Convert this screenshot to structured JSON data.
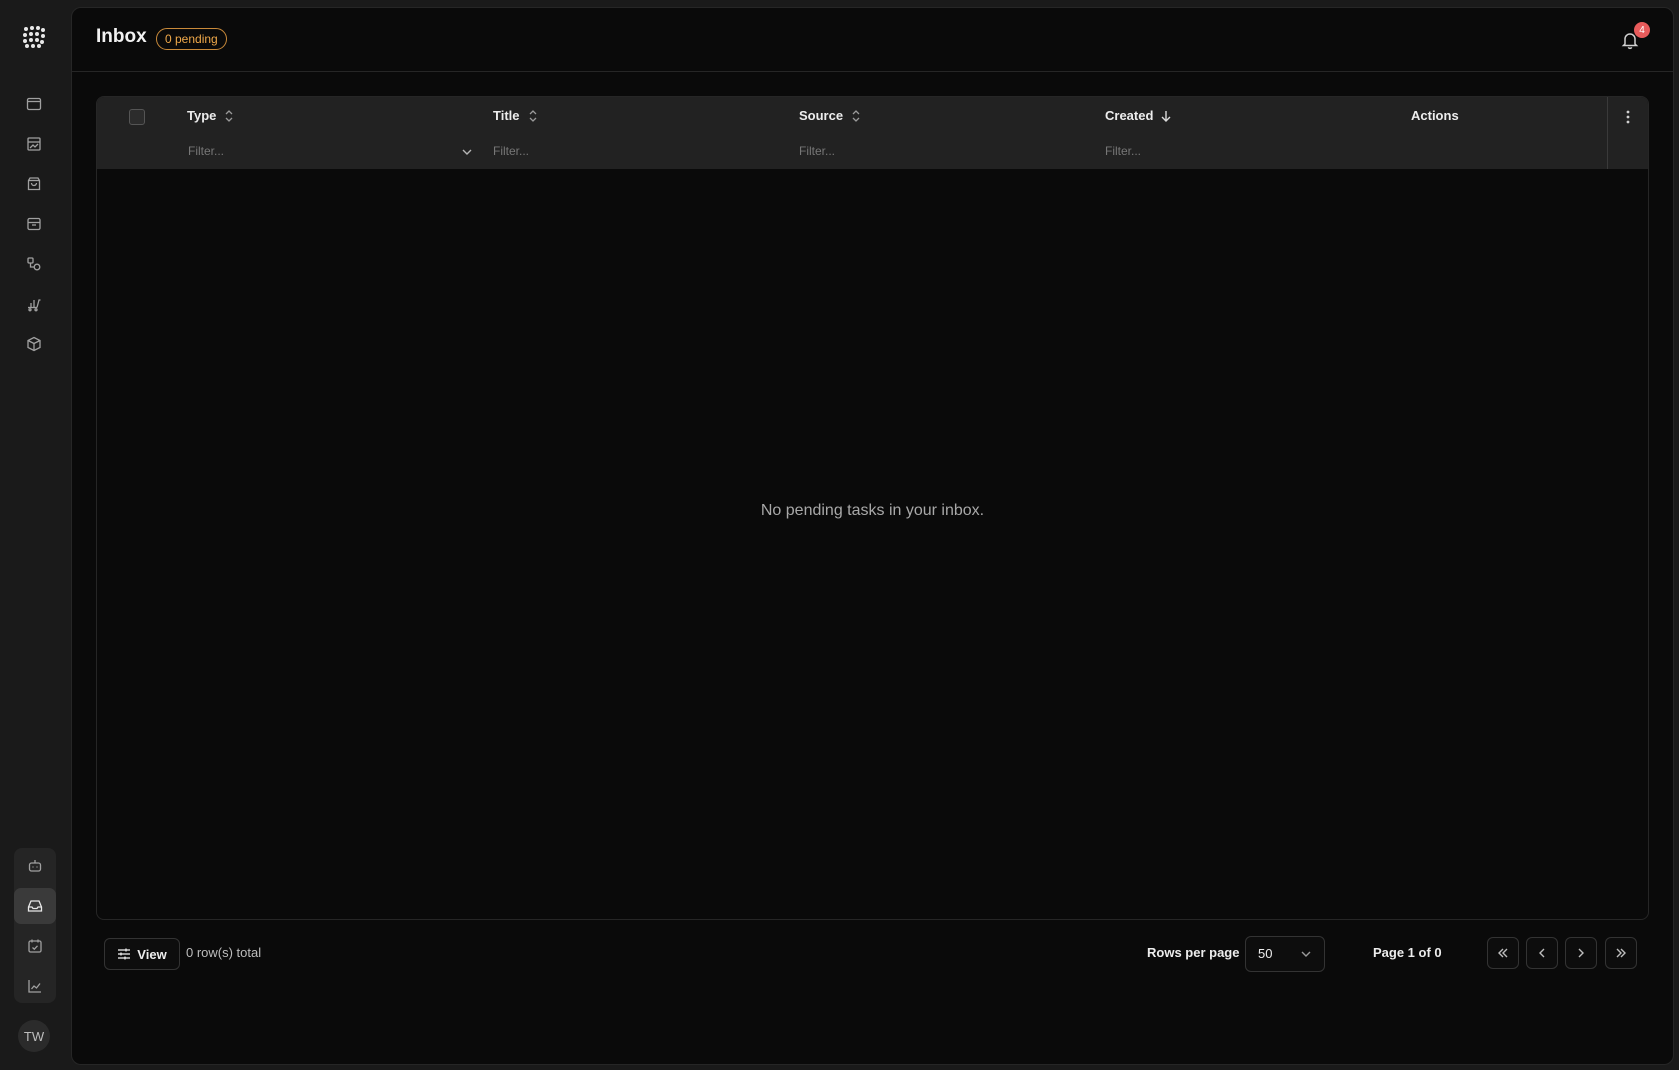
{
  "sidebar": {
    "nav_icons": [
      "window-icon",
      "image-gallery-icon",
      "shopping-bag-icon",
      "archive-icon",
      "shapes-icon",
      "cart-chart-icon",
      "package-icon"
    ],
    "bottom_icons": [
      "bot-icon",
      "inbox-icon",
      "calendar-check-icon",
      "chart-icon"
    ],
    "active_bottom": "inbox-icon",
    "avatar_initials": "TW"
  },
  "header": {
    "title": "Inbox",
    "pending_badge": "0 pending",
    "notification_count": "4"
  },
  "table": {
    "columns": [
      {
        "label": "Type",
        "sort": "unsorted",
        "filter_placeholder": "Filter...",
        "filter_dropdown": true
      },
      {
        "label": "Title",
        "sort": "unsorted",
        "filter_placeholder": "Filter..."
      },
      {
        "label": "Source",
        "sort": "unsorted",
        "filter_placeholder": "Filter..."
      },
      {
        "label": "Created",
        "sort": "descending",
        "filter_placeholder": "Filter..."
      },
      {
        "label": "Actions"
      }
    ],
    "rows": [],
    "empty_message": "No pending tasks in your inbox."
  },
  "footer": {
    "view_label": "View",
    "rows_total": "0 row(s) total",
    "rows_per_page_label": "Rows per page",
    "rows_per_page_value": "50",
    "page_info": "Page 1 of 0"
  },
  "colors": {
    "background": "#0a0a0a",
    "sidebar": "#1a1a1a",
    "badge_accent": "#f0a94a",
    "notification": "#e85b5b"
  }
}
